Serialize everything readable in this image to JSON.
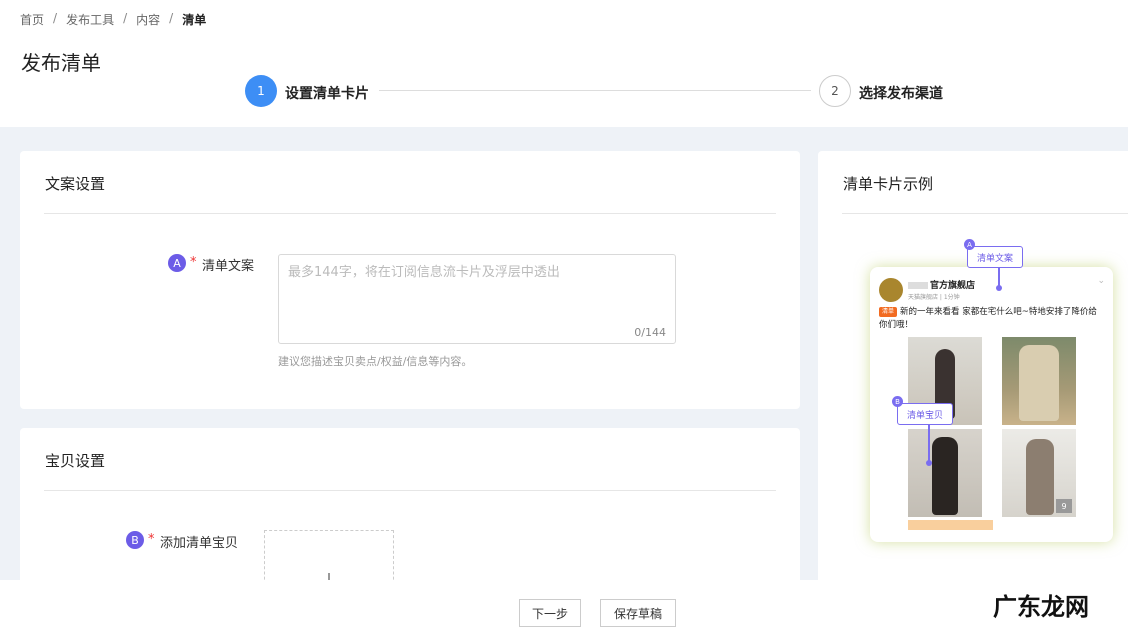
{
  "breadcrumb": {
    "items": [
      "首页",
      "发布工具",
      "内容",
      "清单"
    ],
    "separator": "/"
  },
  "page_title": "发布清单",
  "steps": [
    {
      "number": "1",
      "label": "设置清单卡片",
      "state": "active"
    },
    {
      "number": "2",
      "label": "选择发布渠道",
      "state": "pending"
    }
  ],
  "copy_section": {
    "title": "文案设置",
    "badge": "A",
    "required_mark": "*",
    "field_label": "清单文案",
    "placeholder": "最多144字，将在订阅信息流卡片及浮层中透出",
    "counter": "0/144",
    "hint": "建议您描述宝贝卖点/权益/信息等内容。"
  },
  "item_section": {
    "title": "宝贝设置",
    "badge": "B",
    "required_mark": "*",
    "field_label": "添加清单宝贝"
  },
  "preview": {
    "title": "清单卡片示例",
    "shop_name": "官方旗舰店",
    "shop_sub": "天猫旗舰店 | 1分钟",
    "tag": "清单",
    "post_text": "新的一年来看看 家都在宅什么吧~特地安排了降价给你们哦！",
    "image_count": "9",
    "callout_a": {
      "badge": "A",
      "label": "清单文案"
    },
    "callout_b": {
      "badge": "B",
      "label": "清单宝贝"
    }
  },
  "buttons": {
    "next": "下一步",
    "save_draft": "保存草稿"
  },
  "watermark": "广东龙网",
  "colors": {
    "primary": "#3d8ef5",
    "badge": "#6c5ce7",
    "required": "#e33333"
  }
}
